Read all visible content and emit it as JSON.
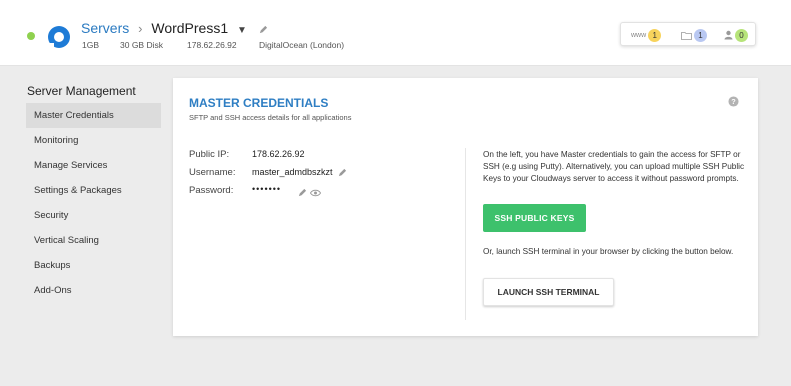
{
  "header": {
    "breadcrumb_root": "Servers",
    "server_name": "WordPress1",
    "specs": {
      "ram": "1GB",
      "disk": "30 GB Disk",
      "ip": "178.62.26.92",
      "provider": "DigitalOcean (London)"
    },
    "status_color": "#8fd14f",
    "provider_logo": "digitalocean-logo",
    "badges": [
      {
        "label": "www",
        "count": "1",
        "color": "#f7d35c",
        "icon": "www-icon"
      },
      {
        "label": "",
        "count": "1",
        "color": "#b9c8f2",
        "icon": "folder-icon"
      },
      {
        "label": "",
        "count": "0",
        "color": "#b7e47a",
        "icon": "user-icon"
      }
    ]
  },
  "sidebar": {
    "title": "Server Management",
    "items": [
      {
        "label": "Master Credentials",
        "active": true
      },
      {
        "label": "Monitoring"
      },
      {
        "label": "Manage Services"
      },
      {
        "label": "Settings & Packages"
      },
      {
        "label": "Security"
      },
      {
        "label": "Vertical Scaling"
      },
      {
        "label": "Backups"
      },
      {
        "label": "Add-Ons"
      }
    ]
  },
  "main": {
    "title": "MASTER CREDENTIALS",
    "subtitle": "SFTP and SSH access details for all applications",
    "fields": {
      "public_ip_label": "Public IP:",
      "public_ip": "178.62.26.92",
      "username_label": "Username:",
      "username": "master_admdbszkzt",
      "password_label": "Password:",
      "password": "•••••••"
    },
    "description_keys": "On the left, you have Master credentials to gain the access for SFTP or SSH (e.g using Putty). Alternatively, you can upload multiple SSH Public Keys to your Cloudways server to access it without password prompts.",
    "ssh_keys_button": "SSH PUBLIC KEYS",
    "description_terminal": "Or, launch SSH terminal in your browser by clicking the button below.",
    "terminal_button": "LAUNCH SSH TERMINAL",
    "accent_color": "#2e7ec3",
    "button_color": "#3dc16c"
  }
}
